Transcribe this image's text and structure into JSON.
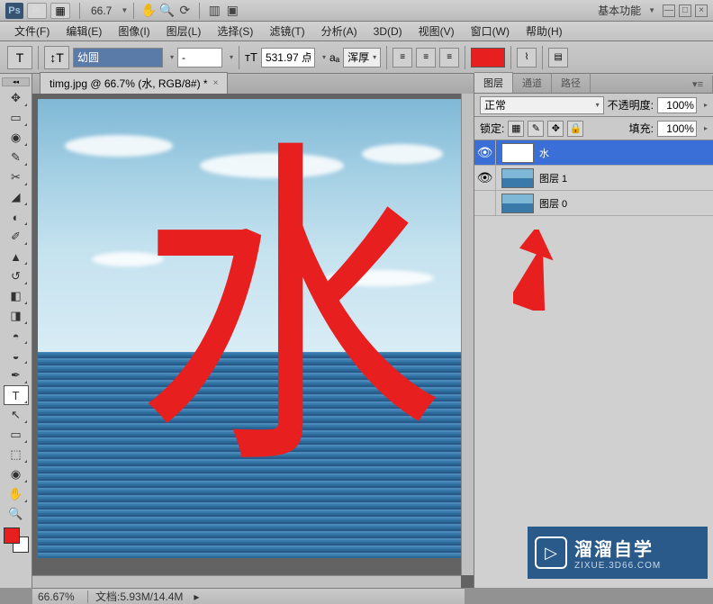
{
  "app_bar": {
    "zoom": "66.7",
    "workspace_label": "基本功能"
  },
  "menu": {
    "file": "文件(F)",
    "edit": "编辑(E)",
    "image": "图像(I)",
    "layer": "图层(L)",
    "select": "选择(S)",
    "filter": "滤镜(T)",
    "analysis": "分析(A)",
    "threed": "3D(D)",
    "view": "视图(V)",
    "window": "窗口(W)",
    "help": "帮助(H)"
  },
  "options": {
    "font_family": "幼圆",
    "font_style": "-",
    "font_size": "531.97 点",
    "aa_label": "aₐ",
    "aa_value": "浑厚"
  },
  "document": {
    "tab_title": "timg.jpg @ 66.7% (水, RGB/8#) *",
    "canvas_text": "水"
  },
  "layers_panel": {
    "tabs": {
      "layers": "图层",
      "channels": "通道",
      "paths": "路径"
    },
    "blend_mode": "正常",
    "opacity_label": "不透明度:",
    "opacity_value": "100%",
    "lock_label": "锁定:",
    "fill_label": "填充:",
    "fill_value": "100%",
    "layers": [
      {
        "name": "水",
        "type": "T",
        "visible": true,
        "selected": true
      },
      {
        "name": "图层 1",
        "type": "img",
        "visible": true,
        "selected": false
      },
      {
        "name": "图层 0",
        "type": "img",
        "visible": false,
        "selected": false
      }
    ]
  },
  "status": {
    "zoom": "66.67%",
    "doc_info": "文档:5.93M/14.4M"
  },
  "watermark": {
    "title": "溜溜自学",
    "subtitle": "ZIXUE.3D66.COM"
  }
}
